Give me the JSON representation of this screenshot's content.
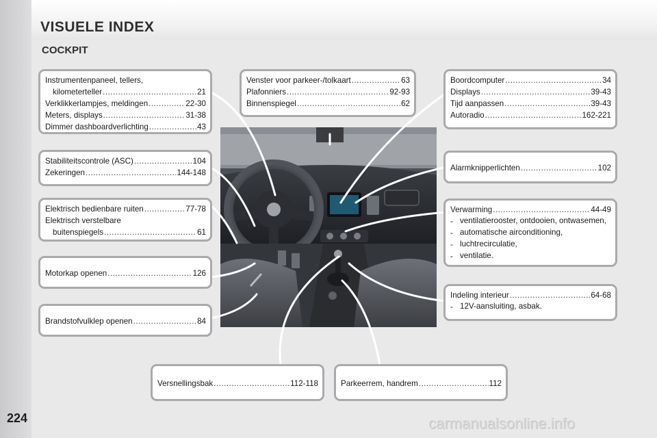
{
  "page": {
    "title": "VISUELE INDEX",
    "section": "COCKPIT",
    "page_number": "224",
    "watermark": "carmanualsonline.info"
  },
  "boxes": {
    "instruments": {
      "entries": [
        {
          "label": "Instrumentenpaneel, tellers,",
          "label2": "kilometerteller",
          "page": "21"
        },
        {
          "label": "Verklikkerlampjes, meldingen",
          "page": "22-30"
        },
        {
          "label": "Meters, displays",
          "page": "31-38"
        },
        {
          "label": "Dimmer dashboardverlichting",
          "page": "43"
        }
      ]
    },
    "stability": {
      "entries": [
        {
          "label": "Stabiliteitscontrole (ASC)",
          "page": "104"
        },
        {
          "label": "Zekeringen",
          "page": "144-148"
        }
      ]
    },
    "windows": {
      "entries": [
        {
          "label": "Elektrisch bedienbare ruiten",
          "page": "77-78"
        },
        {
          "label": "Elektrisch verstelbare",
          "label2": "buitenspiegels",
          "page": "61"
        }
      ]
    },
    "bonnet": {
      "entries": [
        {
          "label": "Motorkap openen",
          "page": "126"
        }
      ]
    },
    "fuel": {
      "entries": [
        {
          "label": "Brandstofvulklep openen",
          "page": "84"
        }
      ]
    },
    "parking_window": {
      "entries": [
        {
          "label": "Venster voor parkeer-/tolkaart",
          "page": "63"
        },
        {
          "label": "Plafonniers",
          "page": "92-93"
        },
        {
          "label": "Binnenspiegel",
          "page": "62"
        }
      ]
    },
    "computer": {
      "entries": [
        {
          "label": "Boordcomputer",
          "page": "34"
        },
        {
          "label": "Displays",
          "page": "39-43"
        },
        {
          "label": "Tijd aanpassen",
          "page": "39-43"
        },
        {
          "label": "Autoradio",
          "page": "162-221"
        }
      ]
    },
    "hazard": {
      "entries": [
        {
          "label": "Alarmknipperlichten",
          "page": "102"
        }
      ]
    },
    "heating": {
      "entries": [
        {
          "label": "Verwarming",
          "page": "44-49"
        }
      ],
      "bullets": [
        "ventilatierooster, ontdooien, ontwasemen,",
        "automatische airconditioning,",
        "luchtrecirculatie,",
        "ventilatie."
      ]
    },
    "interior": {
      "entries": [
        {
          "label": "Indeling interieur",
          "page": "64-68"
        }
      ],
      "bullets": [
        "12V-aansluiting, asbak."
      ]
    },
    "gearbox": {
      "entries": [
        {
          "label": "Versnellingsbak",
          "page": "112-118"
        }
      ]
    },
    "parkbrake": {
      "entries": [
        {
          "label": "Parkeerrem, handrem",
          "page": "112"
        }
      ]
    }
  },
  "colors": {
    "box_border": "#aaaaae",
    "connector": "#ffffff",
    "background": "#e9e9ea"
  }
}
